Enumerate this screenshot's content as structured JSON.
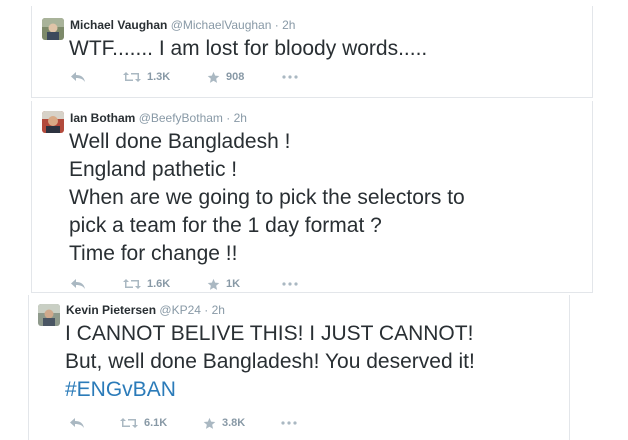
{
  "tweets": [
    {
      "name": "Michael Vaughan",
      "handle": "@MichaelVaughan",
      "time": "2h",
      "lines": [
        "WTF....... I am lost for bloody words....."
      ],
      "retweets": "1.3K",
      "favorites": "908"
    },
    {
      "name": "Ian Botham",
      "handle": "@BeefyBotham",
      "time": "2h",
      "lines": [
        "Well done Bangladesh !",
        "England pathetic !",
        "When are we going to pick the selectors to",
        "pick a team for the 1 day format ?",
        "Time for change !!"
      ],
      "retweets": "1.6K",
      "favorites": "1K"
    },
    {
      "name": "Kevin Pietersen",
      "handle": "@KP24",
      "time": "2h",
      "lines": [
        "I CANNOT BELIVE THIS! I JUST CANNOT!",
        "But, well done Bangladesh! You deserved it!"
      ],
      "hashtag": "#ENGvBAN",
      "retweets": "6.1K",
      "favorites": "3.8K"
    }
  ],
  "separator": "·",
  "colors": {
    "text": "#292f33",
    "muted": "#8899a6",
    "hashtag": "#2b7bb9"
  },
  "icons": [
    "reply-icon",
    "retweet-icon",
    "favorite-icon",
    "more-icon"
  ]
}
